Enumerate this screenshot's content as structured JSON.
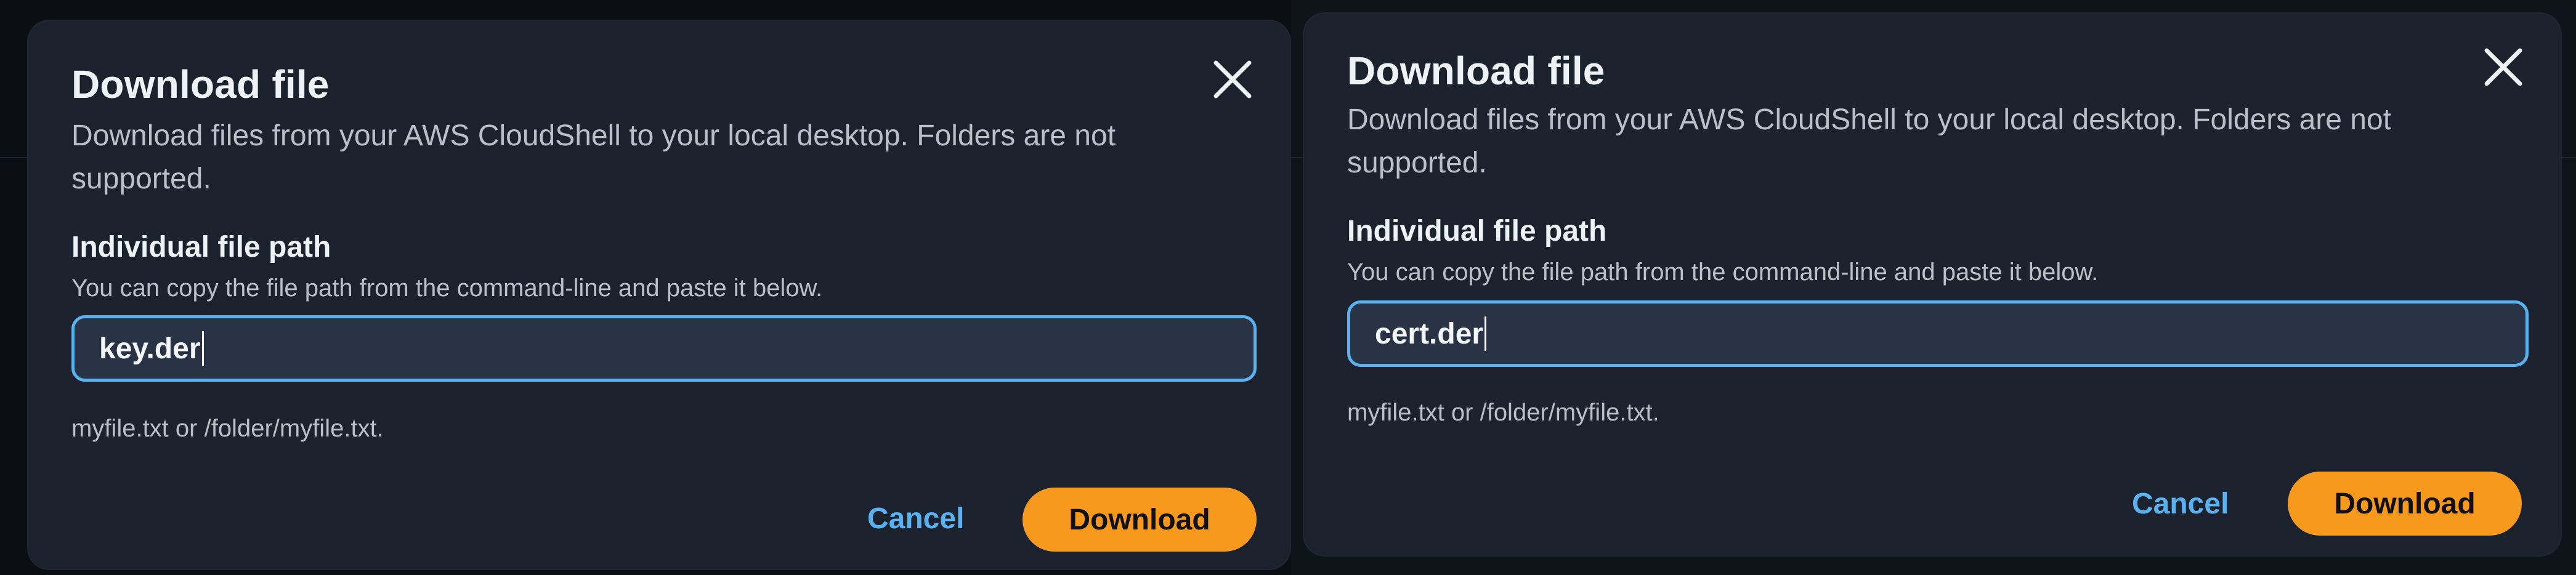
{
  "dialogs": [
    {
      "title": "Download file",
      "description": "Download files from your AWS CloudShell to your local desktop. Folders are not supported.",
      "field": {
        "label": "Individual file path",
        "hint": "You can copy the file path from the command-line and paste it below.",
        "value": "key.der",
        "constraint": "myfile.txt or /folder/myfile.txt."
      },
      "cancel_label": "Cancel",
      "download_label": "Download",
      "close_icon": "close-icon"
    },
    {
      "title": "Download file",
      "description": "Download files from your AWS CloudShell to your local desktop. Folders are not supported.",
      "field": {
        "label": "Individual file path",
        "hint": "You can copy the file path from the command-line and paste it below.",
        "value": "cert.der",
        "constraint": "myfile.txt or /folder/myfile.txt."
      },
      "cancel_label": "Cancel",
      "download_label": "Download",
      "close_icon": "close-icon"
    }
  ],
  "colors": {
    "accent_blue": "#5ab1f0",
    "primary_button": "#f7991d",
    "dialog_bg": "#1b222d",
    "input_bg": "#283346"
  }
}
